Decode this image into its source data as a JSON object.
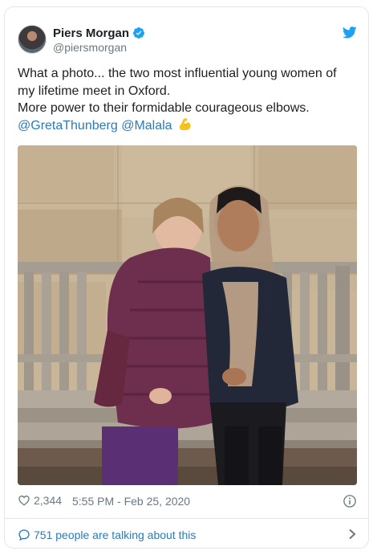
{
  "author": {
    "name": "Piers Morgan",
    "handle": "@piersmorgan",
    "avatar_icon": "user-avatar",
    "verified_icon": "verified-badge-icon"
  },
  "tweet": {
    "lines": [
      "What a photo... the two most influential young women of",
      "my lifetime meet in Oxford.",
      "More power to their formidable courageous elbows."
    ],
    "mentions": [
      "@GretaThunberg",
      "@Malala"
    ],
    "emoji": "flexed-biceps",
    "photo_icon": "photo"
  },
  "meta": {
    "likes": "2,344",
    "timestamp": "5:55 PM - Feb 25, 2020"
  },
  "footer": {
    "talking": "751 people are talking about this"
  },
  "colors": {
    "link": "#2b7bb9",
    "muted": "#697882",
    "twitter_blue": "#1da1f2",
    "border": "#e1e8ed"
  }
}
